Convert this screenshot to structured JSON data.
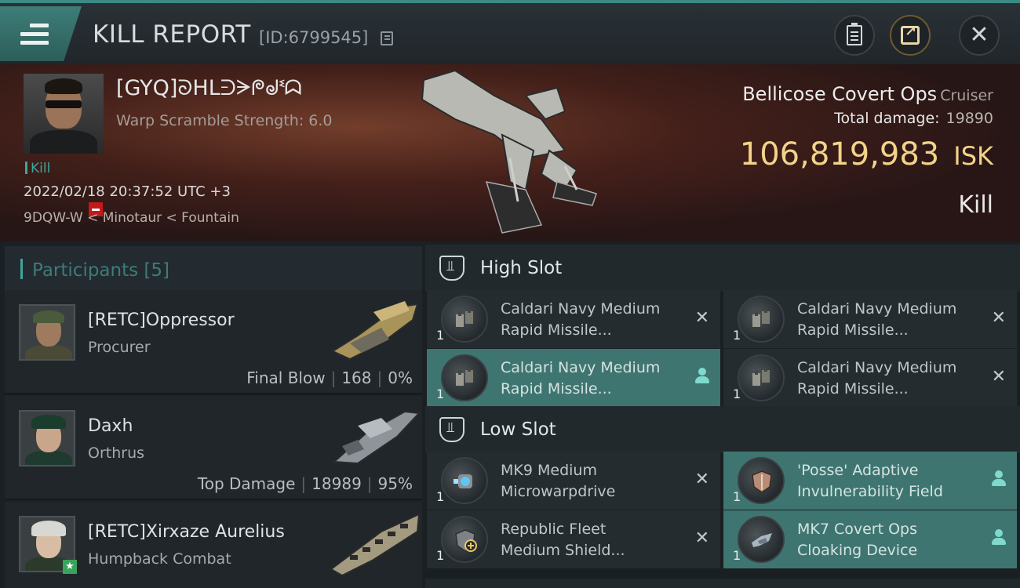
{
  "header": {
    "title": "KILL REPORT",
    "id_text": "[ID:6799545]"
  },
  "victim": {
    "name": "[GYQ]ᘐᕼᒪᕭᗒᖘᖙᓫᗣ",
    "warp_scramble": "Warp Scramble Strength: 6.0",
    "tag": "Kill",
    "datetime": "2022/02/18 20:37:52 UTC +3",
    "location": "9DQW-W < Minotaur < Fountain"
  },
  "ship": {
    "name": "Bellicose Covert Ops",
    "class": "Cruiser",
    "total_damage_label": "Total damage:",
    "total_damage_value": "19890",
    "isk_value": "106,819,983",
    "isk_unit": "ISK",
    "result": "Kill"
  },
  "participants": {
    "label": "Participants [5]",
    "rows": [
      {
        "name": "[RETC]Oppressor",
        "ship": "Procurer",
        "stat_label": "Final Blow",
        "damage": "168",
        "percent": "0%"
      },
      {
        "name": "Daxh",
        "ship": "Orthrus",
        "stat_label": "Top Damage",
        "damage": "18989",
        "percent": "95%"
      },
      {
        "name": "[RETC]Xirxaze Aurelius",
        "ship": "Humpback Combat"
      }
    ]
  },
  "slots": {
    "high_label": "High Slot",
    "low_label": "Low Slot",
    "high": [
      {
        "qty": "1",
        "line1": "Caldari Navy Medium",
        "line2": "Rapid Missile...",
        "active": false,
        "icon": "missile-launcher-icon"
      },
      {
        "qty": "1",
        "line1": "Caldari Navy Medium",
        "line2": "Rapid Missile...",
        "active": false,
        "icon": "missile-launcher-icon"
      },
      {
        "qty": "1",
        "line1": "Caldari Navy Medium",
        "line2": "Rapid Missile...",
        "active": true,
        "icon": "missile-launcher-icon"
      },
      {
        "qty": "1",
        "line1": "Caldari Navy Medium",
        "line2": "Rapid Missile...",
        "active": false,
        "icon": "missile-launcher-icon"
      }
    ],
    "low": [
      {
        "qty": "1",
        "line1": "MK9 Medium",
        "line2": "Microwarpdrive",
        "active": false,
        "icon": "microwarpdrive-icon"
      },
      {
        "qty": "1",
        "line1": "'Posse' Adaptive",
        "line2": "Invulnerability Field",
        "active": true,
        "icon": "shield-hardener-icon"
      },
      {
        "qty": "1",
        "line1": "Republic Fleet",
        "line2": "Medium Shield...",
        "active": false,
        "icon": "shield-booster-icon"
      },
      {
        "qty": "1",
        "line1": "MK7 Covert Ops",
        "line2": "Cloaking Device",
        "active": true,
        "icon": "cloaking-device-icon"
      }
    ]
  },
  "colors": {
    "accent": "#3fa59b",
    "isk": "#f2d389",
    "active_row": "#3f7570"
  }
}
